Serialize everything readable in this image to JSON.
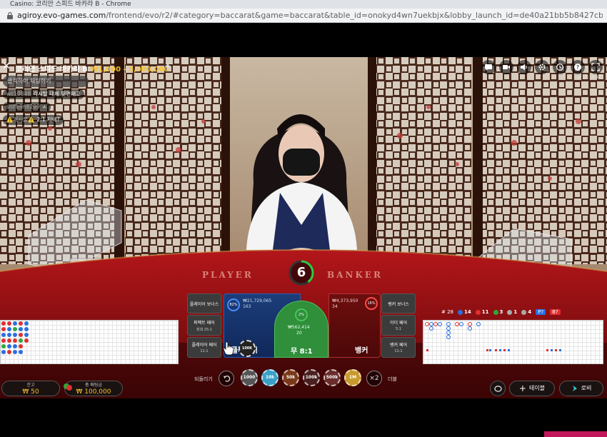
{
  "browser": {
    "title": "Casino: 코리안 스피드 바카라 B - Chrome",
    "url_domain": "agiroy.evo-games.com",
    "url_path": "/frontend/evo/r2/#category=baccarat&game=baccarat&table_id=onokyd4wn7uekbjx&lobby_launch_id=de40a21bb5b8427cb20b885778fd6c15"
  },
  "game": {
    "table_name": "코리안 스피드 바카라 B",
    "limits": "₩1,000 - 5,000,000",
    "clock": "# 17:18:47"
  },
  "chat": {
    "placeholder": "클릭하여 채팅하기",
    "messages": [
      {
        "nick": "wc10848",
        "text": "각시탈 대체 몇연패고"
      },
      {
        "nick": "snlfb9n8299",
        "text": "ㅅ"
      },
      {
        "nick": "⚠️게시물⚠️",
        "text": "2:1 지네?"
      }
    ]
  },
  "table": {
    "player_label": "PLAYER",
    "banker_label": "BANKER",
    "timer": "6"
  },
  "bets": {
    "player_bonus": "플레이어 보너스",
    "perfect_pair": "퍼펙트 페어",
    "perfect_pair_odds": "최대 25:1",
    "player_pair": "플레이어 페어",
    "player_pair_odds": "11:1",
    "player": "플레이어",
    "player_pct": "82%",
    "player_total": "₩21,729,065",
    "player_count": "163",
    "tie": "무 8:1",
    "tie_pct": "2%",
    "tie_total": "₩562,414",
    "tie_count": "20",
    "banker": "뱅커",
    "banker_pct": "16%",
    "banker_total": "₩4,373,950",
    "banker_count": "34",
    "banker_bonus": "뱅커 보너스",
    "either_pair": "이더 페어",
    "either_pair_odds": "5:1",
    "banker_pair": "뱅커 페어",
    "banker_pair_odds": "11:1",
    "chip_on_table": "100K"
  },
  "road_stats": {
    "total": "# 28",
    "player": "14",
    "banker": "11",
    "tie": "3",
    "player_pair": "1",
    "banker_pair": "4"
  },
  "footer": {
    "balance_label": "잔고",
    "balance": "₩ 50",
    "total_bet_label": "총 배팅금",
    "total_bet": "₩ 100,000",
    "undo": "되돌리기",
    "chips": [
      "1000",
      "10k",
      "50k",
      "100k",
      "500k",
      "1M"
    ],
    "double": "×2",
    "double_label": "더블",
    "tables": "테이블",
    "lobby": "로비"
  },
  "colors": {
    "player": "#1c3d7a",
    "banker": "#6d0e0e",
    "tie": "#2f8f3a",
    "gold": "#f2c12e"
  }
}
